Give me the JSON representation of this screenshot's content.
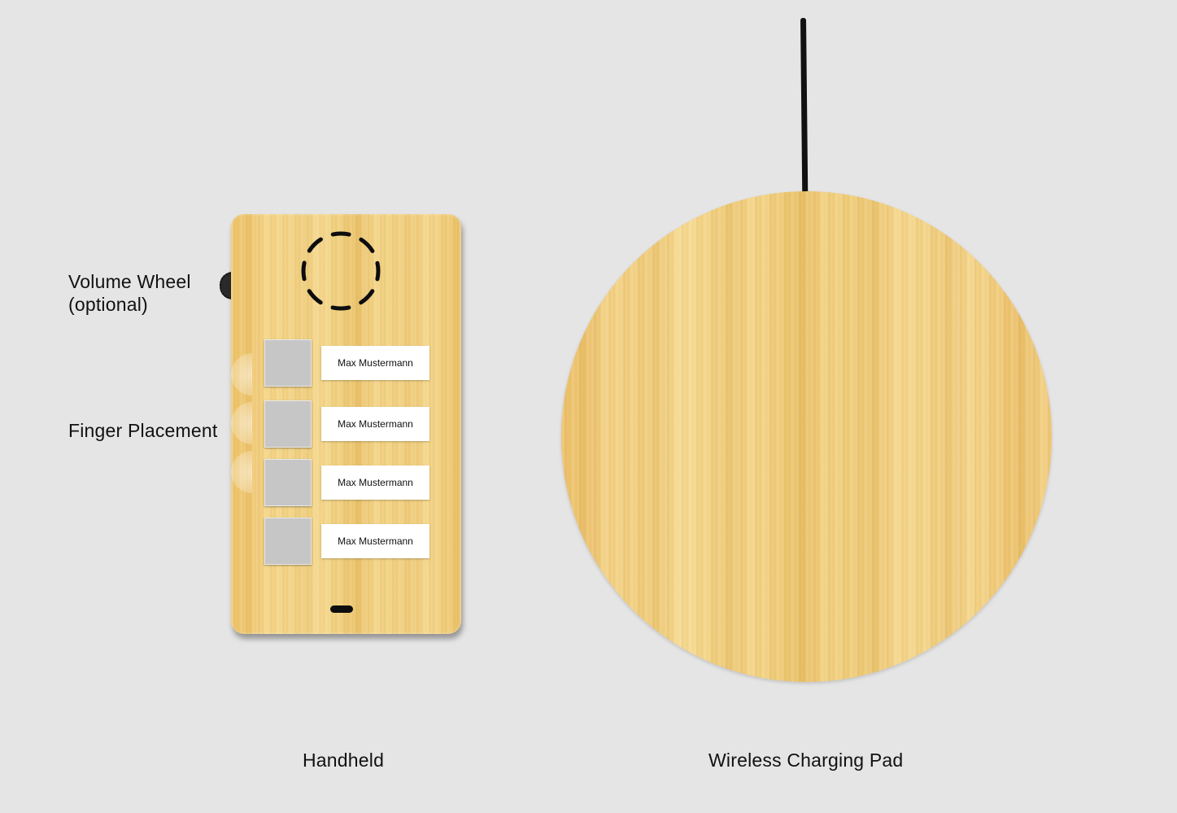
{
  "labels": {
    "volume_wheel_line1": "Volume Wheel",
    "volume_wheel_line2": "(optional)",
    "finger_placement": "Finger Placement",
    "handheld": "Handheld",
    "wireless_charging_pad": "Wireless Charging Pad"
  },
  "handheld": {
    "contacts": [
      {
        "name": "Max Mustermann"
      },
      {
        "name": "Max Mustermann"
      },
      {
        "name": "Max Mustermann"
      },
      {
        "name": "Max Mustermann"
      }
    ]
  },
  "colors": {
    "background": "#e5e5e5",
    "wood": "#f0cf7d",
    "button": "#c6c6c6",
    "cable": "#111111"
  }
}
